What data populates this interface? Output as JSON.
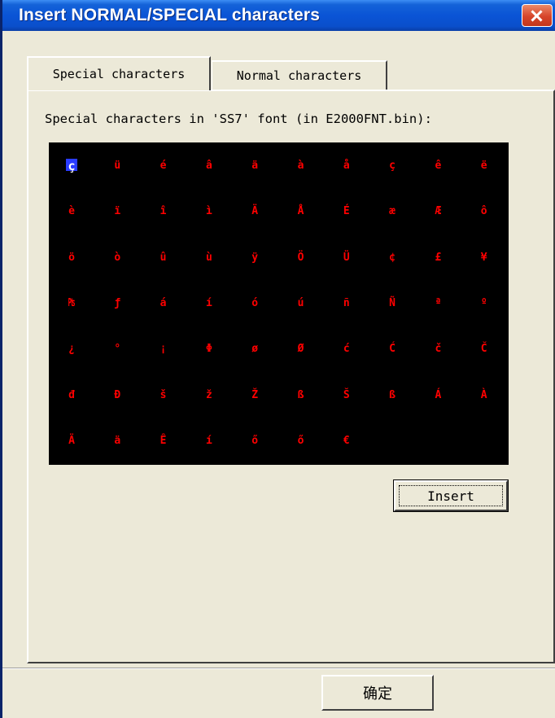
{
  "window": {
    "title": "Insert NORMAL/SPECIAL characters",
    "close_icon": "close-icon"
  },
  "tabs": [
    {
      "label": "Special characters",
      "active": true
    },
    {
      "label": "Normal characters",
      "active": false
    }
  ],
  "panel": {
    "label": "Special characters in 'SS7' font (in E2000FNT.bin):"
  },
  "char_grid": {
    "background": "#000000",
    "char_color": "#ff0000",
    "selected_color": "#ffffff",
    "selected_bg": "#2a3cff",
    "selected_index": 0,
    "rows": [
      [
        "ç",
        "ü",
        "é",
        "â",
        "ä",
        "à",
        "å",
        "ç",
        "ê",
        "ë"
      ],
      [
        "è",
        "ï",
        "î",
        "ì",
        "Ä",
        "Å",
        "É",
        "æ",
        "Æ",
        "ô"
      ],
      [
        "ö",
        "ò",
        "û",
        "ù",
        "ÿ",
        "Ö",
        "Ü",
        "¢",
        "£",
        "¥"
      ],
      [
        "₧",
        "ƒ",
        "á",
        "í",
        "ó",
        "ú",
        "ñ",
        "Ñ",
        "ª",
        "º"
      ],
      [
        "¿",
        "°",
        "¡",
        "Φ",
        "ø",
        "Ø",
        "ć",
        "Ć",
        "č",
        "Č"
      ],
      [
        "đ",
        "Đ",
        "š",
        "ž",
        "Ž",
        "ß",
        "Š",
        "ß",
        "Á",
        "À"
      ],
      [
        "Ä",
        "ä",
        "Ê",
        "í",
        "ő",
        "ő",
        "€"
      ]
    ]
  },
  "buttons": {
    "insert_label": "Insert",
    "ok_label": "确定"
  }
}
